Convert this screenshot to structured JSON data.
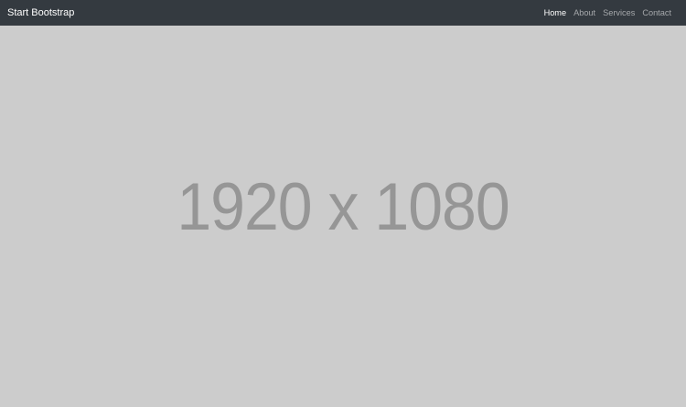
{
  "navbar": {
    "brand": "Start Bootstrap",
    "links": [
      {
        "label": "Home",
        "active": true
      },
      {
        "label": "About",
        "active": false
      },
      {
        "label": "Services",
        "active": false
      },
      {
        "label": "Contact",
        "active": false
      }
    ]
  },
  "hero": {
    "placeholder_text": "1920 x 1080"
  },
  "colors": {
    "navbar_bg": "#343a40",
    "hero_bg": "#cccccc",
    "placeholder_text": "#969696",
    "active_link": "#ffffff",
    "inactive_link": "rgba(255,255,255,0.55)"
  }
}
